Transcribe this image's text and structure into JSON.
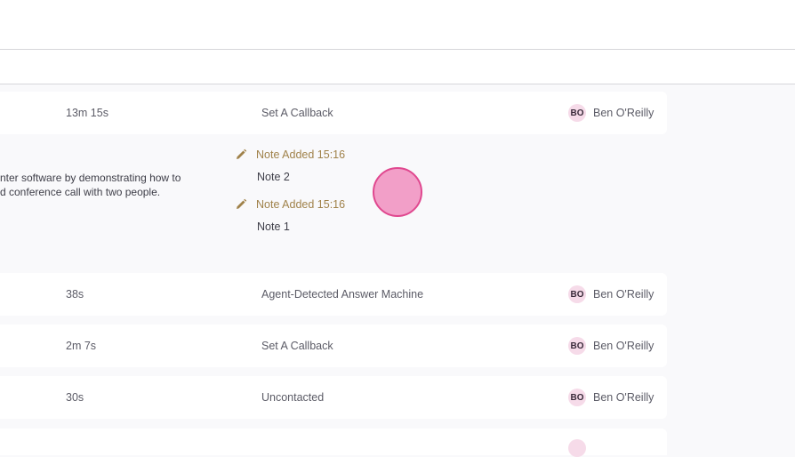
{
  "call_rows": [
    {
      "duration": "13m 15s",
      "outcome": "Set A Callback",
      "agent_initials": "BO",
      "agent_name": "Ben O'Reilly"
    },
    {
      "duration": "38s",
      "outcome": "Agent-Detected Answer Machine",
      "agent_initials": "BO",
      "agent_name": "Ben O'Reilly"
    },
    {
      "duration": "2m 7s",
      "outcome": "Set A Callback",
      "agent_initials": "BO",
      "agent_name": "Ben O'Reilly"
    },
    {
      "duration": "30s",
      "outcome": "Uncontacted",
      "agent_initials": "BO",
      "agent_name": "Ben O'Reilly"
    }
  ],
  "detail": {
    "description_lines": [
      "nter software by demonstrating how to",
      "d conference call with two people."
    ],
    "notes": [
      {
        "header": "Note Added 15:16",
        "body": "Note 2"
      },
      {
        "header": "Note Added 15:16",
        "body": "Note 1"
      }
    ]
  },
  "colors": {
    "note_accent": "#a0824a",
    "badge_bg": "#f6dbe9",
    "cursor_fill": "#f18fbe"
  },
  "icons": {
    "note": "pencil-icon"
  }
}
